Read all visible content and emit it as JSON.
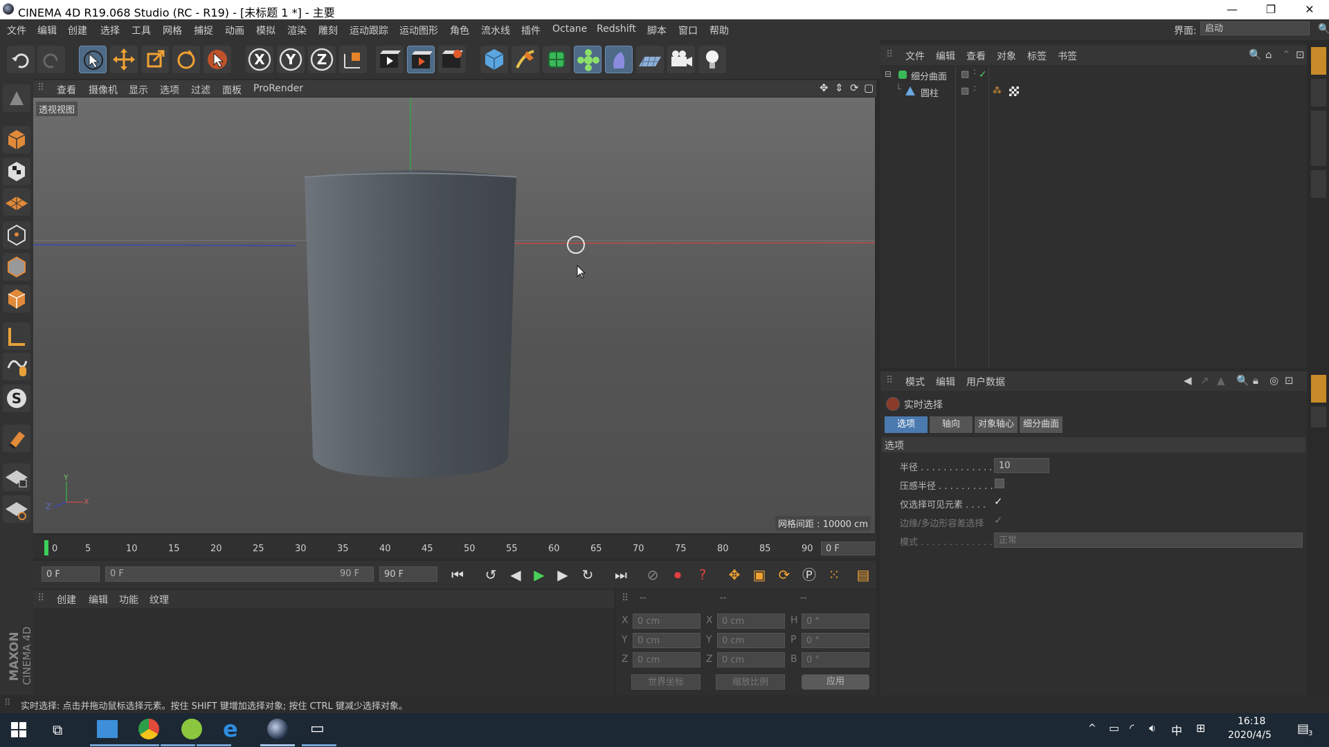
{
  "window": {
    "title": "CINEMA 4D R19.068 Studio (RC - R19) - [未标题 1 *] - 主要",
    "controls": {
      "minimize": "—",
      "restore": "❐",
      "close": "✕"
    }
  },
  "menu": {
    "items": [
      "文件",
      "编辑",
      "创建",
      "选择",
      "工具",
      "网格",
      "捕捉",
      "动画",
      "模拟",
      "渲染",
      "雕刻",
      "运动跟踪",
      "运动图形",
      "角色",
      "流水线",
      "插件",
      "Octane",
      "Redshift",
      "脚本",
      "窗口",
      "帮助"
    ],
    "interface_label": "界面:",
    "interface_value": "启动"
  },
  "toolbar": {
    "icons": [
      "undo-icon",
      "redo-icon",
      "live-select-icon",
      "move-icon",
      "scale-icon",
      "rotate-icon",
      "select-tool-icon",
      "x-axis-icon",
      "y-axis-icon",
      "z-axis-icon",
      "coordinate-system-icon",
      "render-view-icon",
      "render-picture-viewer-icon",
      "render-settings-icon",
      "cube-icon",
      "pen-icon",
      "subdivision-icon",
      "cloner-icon",
      "deformer-icon",
      "floor-icon",
      "camera-icon",
      "light-icon"
    ],
    "axis_labels": [
      "X",
      "Y",
      "Z"
    ]
  },
  "viewport": {
    "menu": [
      "查看",
      "摄像机",
      "显示",
      "选项",
      "过滤",
      "面板",
      "ProRender"
    ],
    "label": "透视视图",
    "grid_info": "网格间距 : 10000 cm",
    "axis_y": "Y",
    "axis_x": "X",
    "axis_z": "Z"
  },
  "timeline": {
    "ticks": [
      "0",
      "5",
      "10",
      "15",
      "20",
      "25",
      "30",
      "35",
      "40",
      "45",
      "50",
      "55",
      "60",
      "65",
      "70",
      "75",
      "80",
      "85",
      "90"
    ],
    "current_frame": "0 F",
    "start_frame": "0 F",
    "range_start": "0 F",
    "range_end": "90 F",
    "end_frame": "90 F"
  },
  "materials": {
    "menu": [
      "创建",
      "编辑",
      "功能",
      "纹理"
    ]
  },
  "coordinates": {
    "header": [
      "--",
      "--",
      "--"
    ],
    "rows": [
      {
        "a": "X",
        "av": "0 cm",
        "b": "X",
        "bv": "0 cm",
        "c": "H",
        "cv": "0 °"
      },
      {
        "a": "Y",
        "av": "0 cm",
        "b": "Y",
        "bv": "0 cm",
        "c": "P",
        "cv": "0 °"
      },
      {
        "a": "Z",
        "av": "0 cm",
        "b": "Z",
        "bv": "0 cm",
        "c": "B",
        "cv": "0 °"
      }
    ],
    "mode1": "世界坐标",
    "mode2": "缩放比例",
    "apply": "应用"
  },
  "objects": {
    "menu": [
      "文件",
      "编辑",
      "查看",
      "对象",
      "标签",
      "书签"
    ],
    "items": [
      {
        "name": "细分曲面",
        "icon": "subdivision-icon"
      },
      {
        "name": "圆柱",
        "icon": "cylinder-icon"
      }
    ]
  },
  "attributes": {
    "menu": [
      "模式",
      "编辑",
      "用户数据"
    ],
    "tool_name": "实时选择",
    "tabs": [
      "选项",
      "轴向",
      "对象轴心",
      "细分曲面"
    ],
    "section": "选项",
    "fields": [
      {
        "label": "半径 . . . . . . . . . . . . .",
        "value": "10"
      },
      {
        "label": "压感半径 . . . . . . . . . .",
        "value": ""
      },
      {
        "label": "仅选择可见元素 . . . .",
        "value": "✓"
      },
      {
        "label": "边缘/多边形容差选择",
        "value": "✓"
      },
      {
        "label": "模式 . . . . . . . . . . . . .",
        "value": "正常"
      }
    ]
  },
  "status": {
    "text": "实时选择: 点击并拖动鼠标选择元素。按住 SHIFT 键增加选择对象; 按住 CTRL 键减少选择对象。"
  },
  "sidebrand": {
    "line1": "MAXON",
    "line2": "CINEMA 4D"
  },
  "taskbar": {
    "time": "16:18",
    "date": "2020/4/5",
    "ime": "中",
    "notification_count": "3"
  }
}
